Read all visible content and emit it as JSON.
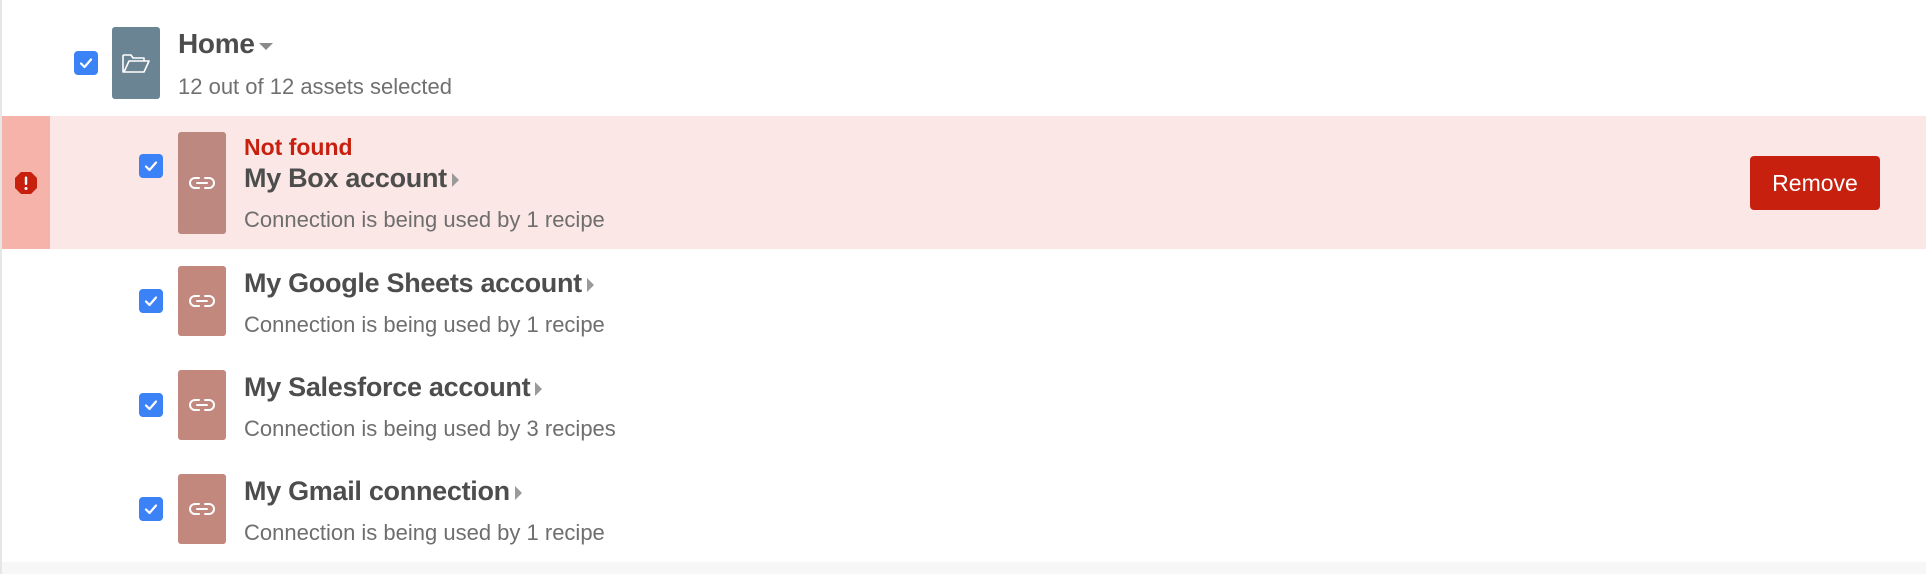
{
  "folder": {
    "title": "Home",
    "summary": "12 out of 12 assets selected",
    "checked": true,
    "icon": "folder-open-icon"
  },
  "items": [
    {
      "status": "Not found",
      "name": "My Box account",
      "description": "Connection is being used by 1 recipe",
      "checked": true,
      "error": true,
      "action_label": "Remove",
      "icon": "link-icon"
    },
    {
      "name": "My Google Sheets account",
      "description": "Connection is being used by 1 recipe",
      "checked": true,
      "icon": "link-icon"
    },
    {
      "name": "My Salesforce account",
      "description": "Connection is being used by 3 recipes",
      "checked": true,
      "icon": "link-icon"
    },
    {
      "name": "My Gmail connection",
      "description": "Connection is being used by 1 recipe",
      "checked": true,
      "icon": "link-icon"
    }
  ],
  "colors": {
    "checkbox": "#3b82f6",
    "folder_tile": "#6b8494",
    "connection_tile": "#c2877d",
    "error_accent": "#c8200f",
    "error_row_bg": "#fbe7e6",
    "error_gutter": "#f6b3aa"
  }
}
